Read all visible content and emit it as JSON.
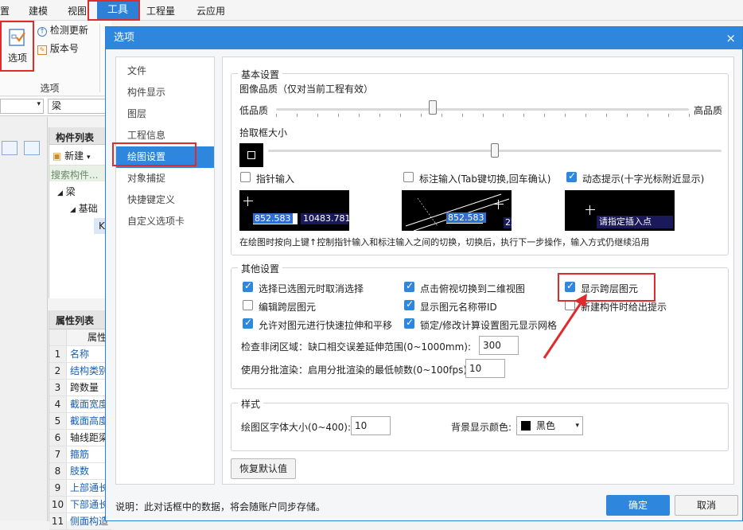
{
  "menubar": {
    "items": [
      "置",
      "建模",
      "视图",
      "工具",
      "工程量",
      "云应用"
    ]
  },
  "ribbon": {
    "options_label": "选项",
    "check_update": "检测更新",
    "version": "版本号",
    "group_label": "选项"
  },
  "left": {
    "combo_value": "梁",
    "component_list_title": "构件列表",
    "new_button": "新建",
    "search_placeholder": "搜索构件...",
    "tree_root": "梁",
    "tree_child": "基础",
    "tree_leaf": "K",
    "property_list_title": "属性列表",
    "property_header": "属性",
    "properties": [
      {
        "num": "1",
        "label": "名称",
        "blue": true
      },
      {
        "num": "2",
        "label": "结构类别",
        "blue": true
      },
      {
        "num": "3",
        "label": "跨数量",
        "blue": false
      },
      {
        "num": "4",
        "label": "截面宽度",
        "blue": true
      },
      {
        "num": "5",
        "label": "截面高度",
        "blue": true
      },
      {
        "num": "6",
        "label": "轴线距梁",
        "blue": false
      },
      {
        "num": "7",
        "label": "箍筋",
        "blue": true
      },
      {
        "num": "8",
        "label": "肢数",
        "blue": true
      },
      {
        "num": "9",
        "label": "上部通长",
        "blue": true
      },
      {
        "num": "10",
        "label": "下部通长",
        "blue": true
      },
      {
        "num": "11",
        "label": "侧面构造",
        "blue": true
      }
    ]
  },
  "dialog": {
    "title": "选项",
    "close": "×",
    "nav": [
      "文件",
      "构件显示",
      "图层",
      "工程信息",
      "绘图设置",
      "对象捕捉",
      "快捷键定义",
      "自定义选项卡"
    ],
    "nav_active_index": 4,
    "basic": {
      "title": "基本设置",
      "image_quality": "图像品质（仅对当前工程有效）",
      "low_quality": "低品质",
      "high_quality": "高品质",
      "quality_level": 0.38,
      "pick_box_size": "拾取框大小",
      "pick_box_level": 0.5,
      "pointer_input": "指针输入",
      "dimension_input": "标注输入(Tab键切换,回车确认)",
      "dynamic_prompt": "动态提示(十字光标附近显示)",
      "pointer_input_checked": false,
      "dimension_input_checked": false,
      "dynamic_prompt_checked": true,
      "preview1_value1": "852.583",
      "preview1_value2": "10483.781",
      "preview2_value1": "852.583",
      "preview2_value2": "22.3",
      "preview3_text": "请指定插入点",
      "hint": "在绘图时按向上键↑控制指针输入和标注输入之间的切换，切换后，执行下一步操作，输入方式仍继续沿用"
    },
    "other": {
      "title": "其他设置",
      "options": [
        {
          "label": "选择已选图元时取消选择",
          "checked": true
        },
        {
          "label": "点击俯视切换到二维视图",
          "checked": true
        },
        {
          "label": "显示跨层图元",
          "checked": true
        },
        {
          "label": "编辑跨层图元",
          "checked": false
        },
        {
          "label": "显示图元名称带ID",
          "checked": true
        },
        {
          "label": "新建构件时给出提示",
          "checked": false
        },
        {
          "label": "允许对图元进行快速拉伸和平移",
          "checked": true
        },
        {
          "label": "锁定/修改计算设置图元显示网格",
          "checked": true
        }
      ],
      "gap_range_label": "检查非闭区域：缺口相交误差延伸范围(0~1000mm):",
      "gap_range_value": "300",
      "batch_render_label": "使用分批渲染：启用分批渲染的最低帧数(0~100fps):",
      "batch_render_value": "10"
    },
    "style": {
      "title": "样式",
      "font_size_label": "绘图区字体大小(0~400):",
      "font_size_value": "10",
      "bg_color_label": "背景显示颜色:",
      "bg_color_value": "黑色",
      "bg_color_swatch": "#000000"
    },
    "restore_default": "恢复默认值",
    "footer_note": "说明：此对话框中的数据，将会随账户同步存储。",
    "ok": "确定",
    "cancel": "取消"
  },
  "colors": {
    "accent": "#2f86dd",
    "annotation_red": "#e02b2b"
  }
}
